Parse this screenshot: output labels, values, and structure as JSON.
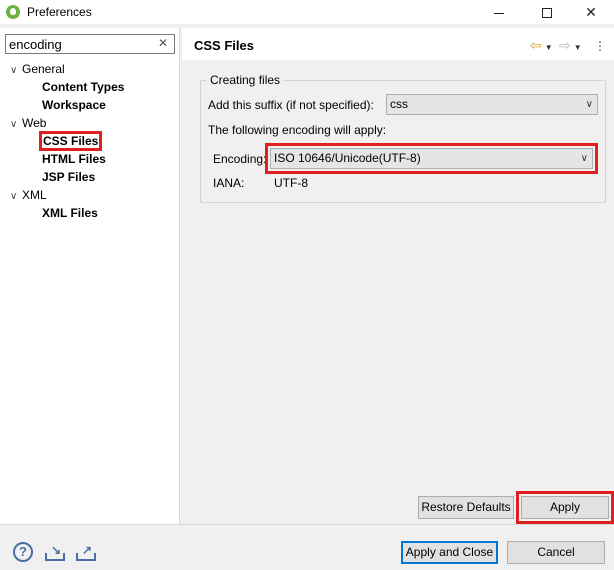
{
  "window": {
    "title": "Preferences",
    "controls": {
      "minimize": "minimize",
      "maximize": "maximize",
      "close": "✕"
    }
  },
  "filter": {
    "value": "encoding",
    "clear_icon": "✕"
  },
  "tree": [
    {
      "label": "General",
      "level": 0,
      "expanded": true
    },
    {
      "label": "Content Types",
      "level": 1
    },
    {
      "label": "Workspace",
      "level": 1
    },
    {
      "label": "Web",
      "level": 0,
      "expanded": true
    },
    {
      "label": "CSS Files",
      "level": 1,
      "selected": true
    },
    {
      "label": "HTML Files",
      "level": 1
    },
    {
      "label": "JSP Files",
      "level": 1
    },
    {
      "label": "XML",
      "level": 0,
      "expanded": true
    },
    {
      "label": "XML Files",
      "level": 1
    }
  ],
  "page": {
    "title": "CSS Files",
    "nav_icons": [
      "back-arrow-icon",
      "dropdown-icon",
      "forward-arrow-icon",
      "dropdown-icon",
      "view-menu-icon"
    ],
    "group": {
      "legend": "Creating files",
      "suffix_label": "Add this suffix (if not specified):",
      "suffix_value": "css",
      "encoding_note": "The following encoding will apply:",
      "encoding_label": "Encoding:",
      "encoding_value": "ISO 10646/Unicode(UTF-8)",
      "iana_label": "IANA:",
      "iana_value": "UTF-8"
    },
    "restore_defaults": "Restore Defaults",
    "apply": "Apply"
  },
  "footer": {
    "help_icon": "help-icon",
    "import_icon": "import-icon",
    "export_icon": "export-icon",
    "apply_and_close": "Apply and Close",
    "cancel": "Cancel"
  },
  "colors": {
    "highlight": "#e02020",
    "spring_green": "#6db33f",
    "focus_blue": "#0078d7"
  }
}
